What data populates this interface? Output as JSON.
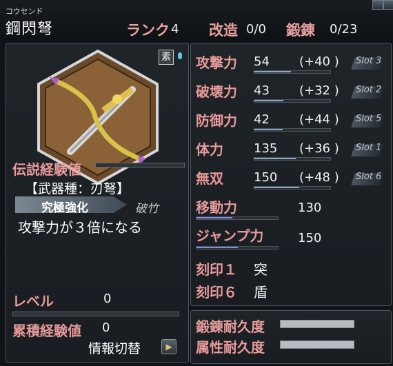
{
  "header": {
    "furigana": "コウセンド",
    "weapon_name": "鋼閃弩",
    "rank_label": "ランク",
    "rank_value": "4",
    "kaizo_label": "改造",
    "kaizo_value": "0/0",
    "tanren_label": "鍛錬",
    "tanren_value": "0/23"
  },
  "left": {
    "element_badge": "素",
    "legend_label": "伝説経験値",
    "weapon_type": "【武器種：刃弩】",
    "skill_name": "究極強化",
    "skill_sub": "破竹",
    "skill_desc": "攻撃力が３倍になる",
    "level_label": "レベル",
    "level_value": "0",
    "exp_label": "累積経験値",
    "exp_value": "0",
    "toggle_label": "情報切替",
    "toggle_icon": "▶"
  },
  "stats": [
    {
      "label": "攻撃力",
      "value": "54",
      "bonus": "(+40 )",
      "slot": "Slot 3",
      "fill": 0.49
    },
    {
      "label": "破壊力",
      "value": "43",
      "bonus": "(+32 )",
      "slot": "Slot 2",
      "fill": 0.39
    },
    {
      "label": "防御力",
      "value": "42",
      "bonus": "(+44 )",
      "slot": "Slot 5",
      "fill": 0.38
    },
    {
      "label": "体力",
      "value": "135",
      "bonus": "(+36 )",
      "slot": "Slot 1",
      "fill": 0.55
    },
    {
      "label": "無双",
      "value": "150",
      "bonus": "(+48 )",
      "slot": "Slot 6",
      "fill": 0.6
    }
  ],
  "movement": {
    "label": "移動力",
    "value": "130",
    "fill": 0.45
  },
  "jump": {
    "label": "ジャンプ力",
    "value": "150",
    "fill": 0.52
  },
  "seals": [
    {
      "label": "刻印１",
      "value": "突"
    },
    {
      "label": "刻印６",
      "value": "盾"
    }
  ],
  "durability": {
    "tanren_label": "鍛錬耐久度",
    "zokusei_label": "属性耐久度"
  },
  "colors": {
    "label_red": "#e89a9a",
    "bar_blue": "#8da6c8",
    "accent_cyan": "#58c7e8"
  }
}
